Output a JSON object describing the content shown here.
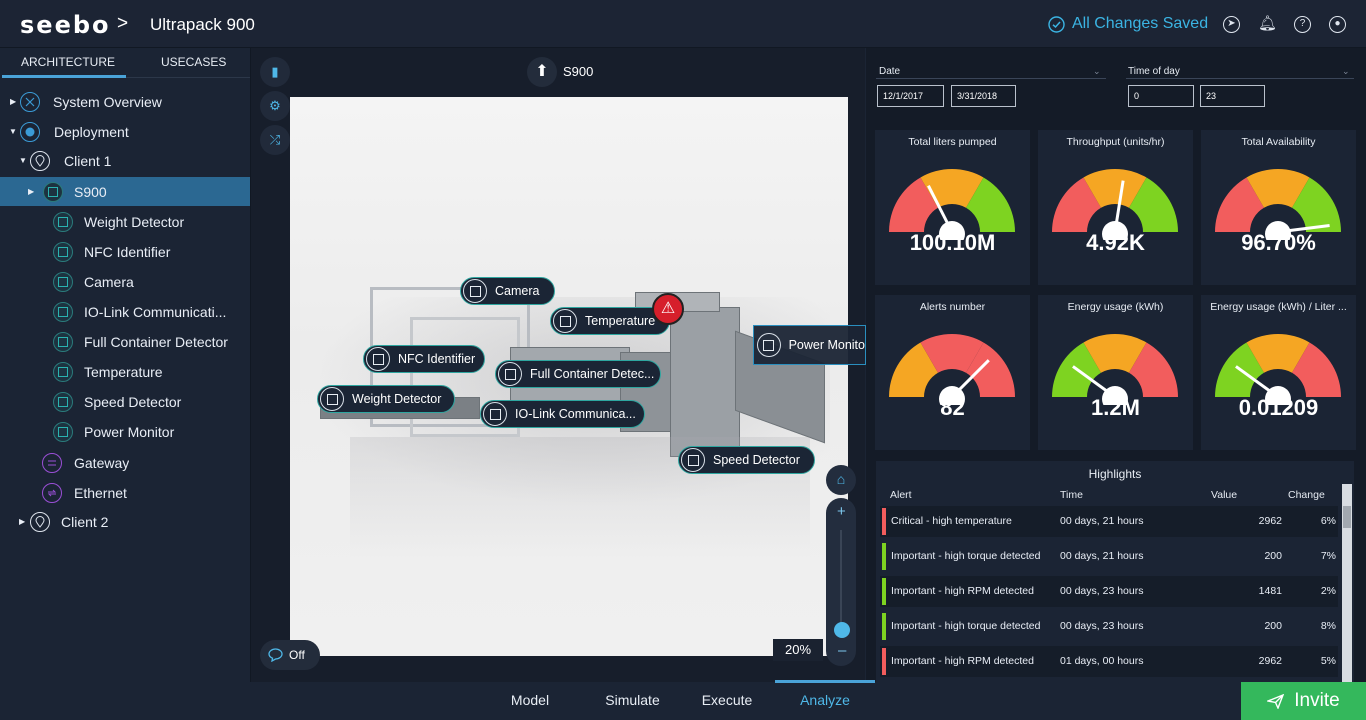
{
  "header": {
    "logo": "seebo",
    "separator": ">",
    "title": "Ultrapack 900",
    "saved_status": "All Changes Saved",
    "icons": [
      "send-icon",
      "bell-icon",
      "help-icon",
      "user-icon"
    ]
  },
  "sidebar": {
    "tabs": [
      "ARCHITECTURE",
      "USECASES"
    ],
    "active_tab": "ARCHITECTURE",
    "tree": [
      {
        "label": "System Overview",
        "icon": "network-icon"
      },
      {
        "label": "Deployment",
        "icon": "deployment-icon"
      },
      {
        "label": "Client 1",
        "icon": "location-pin-icon"
      },
      {
        "label": "S900",
        "icon": "cube-icon"
      },
      {
        "label": "Weight Detector",
        "icon": "cube-icon"
      },
      {
        "label": "NFC Identifier",
        "icon": "cube-icon"
      },
      {
        "label": "Camera",
        "icon": "cube-icon"
      },
      {
        "label": "IO-Link Communicati...",
        "icon": "cube-icon"
      },
      {
        "label": "Full Container Detector",
        "icon": "cube-icon"
      },
      {
        "label": "Temperature",
        "icon": "cube-icon"
      },
      {
        "label": "Speed Detector",
        "icon": "cube-icon"
      },
      {
        "label": "Power Monitor",
        "icon": "cube-icon"
      },
      {
        "label": "Gateway",
        "icon": "gateway-icon"
      },
      {
        "label": "Ethernet",
        "icon": "ethernet-icon"
      },
      {
        "label": "Client 2",
        "icon": "location-pin-icon"
      }
    ]
  },
  "viewer": {
    "node_label": "S900",
    "tags": {
      "camera": "Camera",
      "temperature": "Temperature",
      "power": "Power Monito",
      "nfc": "NFC Identifier",
      "full": "Full Container Detec...",
      "weight": "Weight Detector",
      "iolink": "IO-Link Communica...",
      "speed": "Speed Detector"
    },
    "alert_icon": "warning-icon",
    "zoom": "20%",
    "zoom_plus": "+",
    "zoom_minus": "–",
    "comments_toggle": "Off"
  },
  "bottom_tabs": [
    "Model",
    "Simulate",
    "Execute",
    "Analyze"
  ],
  "active_bottom_tab": "Analyze",
  "invite_label": "Invite",
  "filters": {
    "date_label": "Date",
    "date_from": "12/1/2017",
    "date_to": "3/31/2018",
    "time_label": "Time of day",
    "time_from": "0",
    "time_to": "23"
  },
  "gauges": [
    {
      "title": "Total liters pumped",
      "value": "100.10M",
      "needle_pct": 0.35,
      "colors": [
        "#f25d5d",
        "#f5a623",
        "#7ed321"
      ]
    },
    {
      "title": "Throughput (units/hr)",
      "value": "4.92K",
      "needle_pct": 0.55,
      "colors": [
        "#f25d5d",
        "#f5a623",
        "#7ed321"
      ]
    },
    {
      "title": "Total Availability",
      "value": "96.70%",
      "needle_pct": 0.96,
      "colors": [
        "#f25d5d",
        "#f5a623",
        "#7ed321"
      ]
    },
    {
      "title": "Alerts number",
      "value": "82",
      "needle_pct": 0.75,
      "colors": [
        "#f5a623",
        "#f25d5d",
        "#f25d5d"
      ]
    },
    {
      "title": "Energy usage (kWh)",
      "value": "1.2M",
      "needle_pct": 0.2,
      "colors": [
        "#7ed321",
        "#f5a623",
        "#f25d5d"
      ]
    },
    {
      "title": "Energy usage (kWh) / Liter ...",
      "value": "0.01209",
      "needle_pct": 0.2,
      "colors": [
        "#7ed321",
        "#f5a623",
        "#f25d5d"
      ]
    }
  ],
  "highlights": {
    "title": "Highlights",
    "columns": [
      "Alert",
      "Time",
      "Value",
      "Change"
    ],
    "rows": [
      {
        "alert": "Critical - high temperature",
        "time": "00 days, 21 hours",
        "value": "2962",
        "change": "6%",
        "color": "#f25d5d"
      },
      {
        "alert": "Important - high torque detected",
        "time": "00 days, 21 hours",
        "value": "200",
        "change": "7%",
        "color": "#7ed321"
      },
      {
        "alert": "Important - high RPM detected",
        "time": "00 days, 23 hours",
        "value": "1481",
        "change": "2%",
        "color": "#7ed321"
      },
      {
        "alert": "Important - high torque detected",
        "time": "00 days, 23 hours",
        "value": "200",
        "change": "8%",
        "color": "#7ed321"
      },
      {
        "alert": "Important - high RPM detected",
        "time": "01 days, 00 hours",
        "value": "2962",
        "change": "5%",
        "color": "#f25d5d"
      }
    ]
  }
}
